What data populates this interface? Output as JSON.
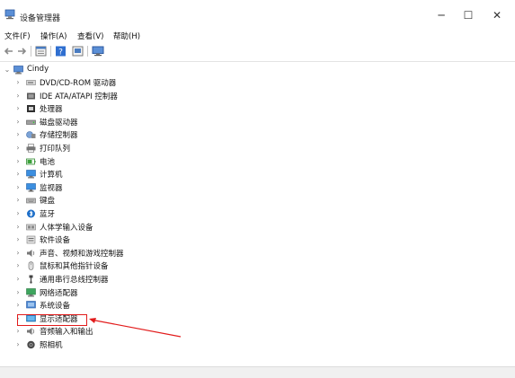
{
  "window": {
    "title": "设备管理器"
  },
  "menu": [
    "文件(F)",
    "操作(A)",
    "查看(V)",
    "帮助(H)"
  ],
  "tree": {
    "root": "Cindy",
    "items": [
      {
        "label": "DVD/CD-ROM 驱动器",
        "icon": "dvd-drive-icon"
      },
      {
        "label": "IDE ATA/ATAPI 控制器",
        "icon": "ide-controller-icon"
      },
      {
        "label": "处理器",
        "icon": "processor-icon"
      },
      {
        "label": "磁盘驱动器",
        "icon": "disk-drive-icon"
      },
      {
        "label": "存储控制器",
        "icon": "storage-controller-icon"
      },
      {
        "label": "打印队列",
        "icon": "printer-icon"
      },
      {
        "label": "电池",
        "icon": "battery-icon"
      },
      {
        "label": "计算机",
        "icon": "computer-icon"
      },
      {
        "label": "监视器",
        "icon": "monitor-icon"
      },
      {
        "label": "键盘",
        "icon": "keyboard-icon"
      },
      {
        "label": "蓝牙",
        "icon": "bluetooth-icon"
      },
      {
        "label": "人体学输入设备",
        "icon": "hid-icon"
      },
      {
        "label": "软件设备",
        "icon": "software-device-icon"
      },
      {
        "label": "声音、视频和游戏控制器",
        "icon": "sound-icon"
      },
      {
        "label": "鼠标和其他指针设备",
        "icon": "mouse-icon"
      },
      {
        "label": "通用串行总线控制器",
        "icon": "usb-icon"
      },
      {
        "label": "网络适配器",
        "icon": "network-adapter-icon"
      },
      {
        "label": "系统设备",
        "icon": "system-device-icon"
      },
      {
        "label": "显示适配器",
        "icon": "display-adapter-icon"
      },
      {
        "label": "音频输入和输出",
        "icon": "audio-io-icon"
      },
      {
        "label": "照相机",
        "icon": "camera-icon"
      }
    ]
  },
  "colors": {
    "highlight": "#e21b1b",
    "accent": "#1e6fc9"
  }
}
